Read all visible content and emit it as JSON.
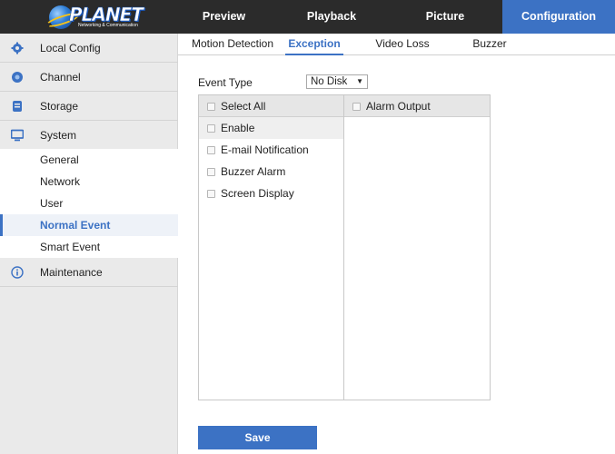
{
  "brand": {
    "logo_text": "PLANET",
    "logo_sub": "Networking & Communication"
  },
  "nav": {
    "tabs": [
      {
        "label": "Preview"
      },
      {
        "label": "Playback"
      },
      {
        "label": "Picture"
      },
      {
        "label": "Configuration",
        "active": true
      }
    ]
  },
  "sidebar": {
    "items": [
      {
        "label": "Local Config",
        "icon": "gear-icon"
      },
      {
        "label": "Channel",
        "icon": "camera-icon"
      },
      {
        "label": "Storage",
        "icon": "storage-icon"
      },
      {
        "label": "System",
        "icon": "monitor-icon"
      },
      {
        "label": "Maintenance",
        "icon": "info-icon"
      }
    ],
    "system_sub": [
      {
        "label": "General"
      },
      {
        "label": "Network"
      },
      {
        "label": "User"
      },
      {
        "label": "Normal Event",
        "active": true
      },
      {
        "label": "Smart Event"
      }
    ]
  },
  "subtabs": [
    {
      "label": "Motion Detection"
    },
    {
      "label": "Exception",
      "active": true
    },
    {
      "label": "Video Loss"
    },
    {
      "label": "Buzzer"
    }
  ],
  "form": {
    "event_type_label": "Event Type",
    "event_type_value": "No Disk",
    "event_type_arrow": "▼",
    "select_all_label": "Select All",
    "alarm_output_label": "Alarm Output",
    "actions": [
      {
        "label": "Enable"
      },
      {
        "label": "E-mail Notification"
      },
      {
        "label": "Buzzer Alarm"
      },
      {
        "label": "Screen Display"
      }
    ],
    "save_label": "Save"
  },
  "colors": {
    "accent": "#3c72c4",
    "topbar": "#2b2b2b",
    "sidebar_bg": "#eaeaea"
  }
}
